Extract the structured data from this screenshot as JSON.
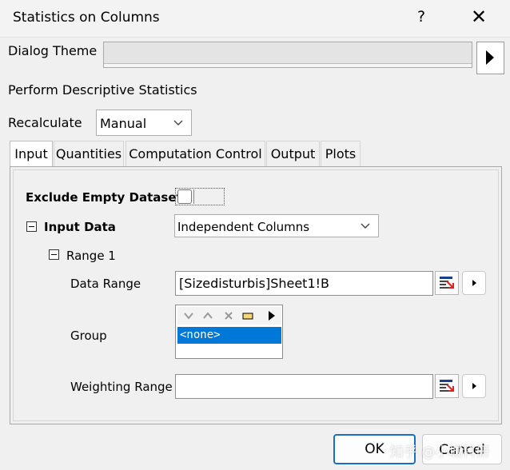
{
  "window": {
    "title": "Statistics on Columns",
    "help_label": "?",
    "close_label": "✕"
  },
  "dialog_theme": {
    "label": "Dialog Theme",
    "value": ""
  },
  "section_title": "Perform Descriptive Statistics",
  "recalculate": {
    "label": "Recalculate",
    "value": "Manual"
  },
  "tabs": [
    {
      "label": "Input",
      "active": true
    },
    {
      "label": "Quantities"
    },
    {
      "label": "Computation Control"
    },
    {
      "label": "Output"
    },
    {
      "label": "Plots"
    }
  ],
  "input": {
    "exclude_empty_label": "Exclude Empty Dataset",
    "input_data_label": "Input Data",
    "input_data_value": "Independent Columns",
    "range_label": "Range 1",
    "data_range_label": "Data Range",
    "data_range_value": "[Sizedisturbis]Sheet1!B",
    "group_label": "Group",
    "group_items": [
      "<none>"
    ],
    "weighting_label": "Weighting Range",
    "weighting_value": ""
  },
  "buttons": {
    "ok": "OK",
    "cancel": "Cancel"
  },
  "watermark": "知乎 @小城科研",
  "colors": {
    "selection": "#0078d7",
    "ok_border": "#1a6fc4"
  }
}
